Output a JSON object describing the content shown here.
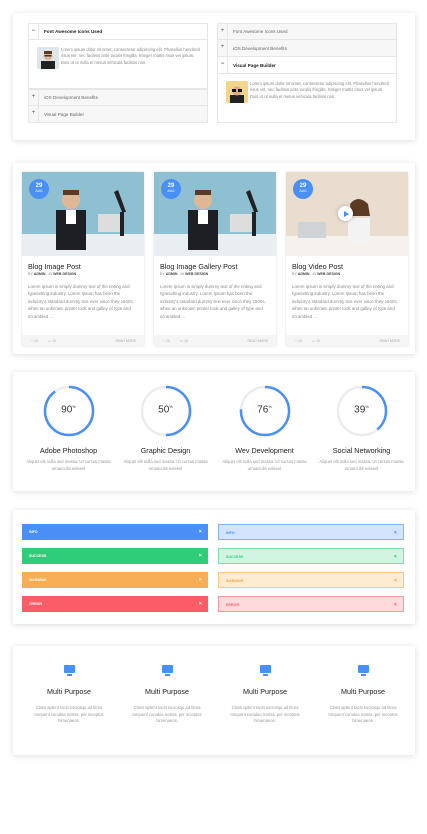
{
  "accordion": {
    "left": {
      "open_title": "Font Awesome Icons Used",
      "body": "Lorem ipsum dolor sit amet, consectetur adipiscing elit. Phasellus hendrerit risus vel, nec facilisis ante iaculis fringilla. Integer mattis risus vel ipsum. Duis ut ut nulla et metus vehicula facilisis non.",
      "items": [
        "iOS Development Benefits",
        "Visual Page Builder"
      ]
    },
    "right": {
      "items_top": [
        "Font Awesome Icons Used",
        "iOS Development Benefits"
      ],
      "open_title": "Visual Page Builder",
      "body": "Lorem ipsum dolor sit amet, consectetur adipiscing elit. Phasellus hendrerit risus vel, nec facilisis ante iaculis fringilla. Integer mattis risus vel ipsum. Duis ut ut nulla et metus vehicula facilisis non."
    }
  },
  "posts": [
    {
      "day": "29",
      "month": "AUG",
      "title": "Blog Image Post",
      "by": "BY",
      "author": "ADMIN",
      "in": "IN",
      "category": "WEB DESIGN",
      "excerpt": "Lorem Ipsum is simply dummy text of the rinting and typesetting industry. Lorem Ipsum has been the industry's standard dummy text ever since they 1500s, when an unknown printer took and galley of type and scrambled ...",
      "likes": "10",
      "comments": "10",
      "read_more": "READ MORE"
    },
    {
      "day": "29",
      "month": "AUG",
      "title": "Blog Image Gallery Post",
      "by": "BY",
      "author": "ADMIN",
      "in": "IN",
      "category": "WEB DESIGN",
      "excerpt": "Lorem Ipsum is simply dummy text of the rinting and typesetting industry. Lorem Ipsum has been the industry's standard dummy text ever since they 1500s, when an unknown printer took and galley of type and scrambled ...",
      "likes": "10",
      "comments": "10",
      "read_more": "READ MORE"
    },
    {
      "day": "29",
      "month": "AUG",
      "title": "Blog Video Post",
      "by": "BY",
      "author": "ADMIN",
      "in": "IN",
      "category": "WEB DESIGN",
      "excerpt": "Lorem Ipsum is simply dummy text of the rinting and typesetting industry. Lorem Ipsum has been the industry's standard dummy text ever since they 1500s, when an unknown printer took and galley of type and scrambled ...",
      "likes": "10",
      "comments": "10",
      "read_more": "READ MORE"
    }
  ],
  "stats": [
    {
      "value": 90,
      "label": "Adobe Photoshop",
      "desc": "Aliquet elit nulla sed massa. Ut cursus massa urnaeculis eeleeel"
    },
    {
      "value": 50,
      "label": "Graphic Design",
      "desc": "Aliquet elit nulla sed massa. Ut cursus massa urnaeculis eeleeel"
    },
    {
      "value": 76,
      "label": "Wev Development",
      "desc": "Aliquet elit nulla sed massa. Ut cursus massa urnaeculis eeleeel"
    },
    {
      "value": 39,
      "label": "Social Networking",
      "desc": "Aliquet elit nulla sed massa. Ut cursus massa urnaeculis eeleeel"
    }
  ],
  "percent_sign": "%",
  "alerts": {
    "solid": [
      "INFO",
      "SUCCESS",
      "WARNING",
      "ERROR"
    ],
    "light": [
      "INFO",
      "SUCCESS",
      "WARNING",
      "ERROR"
    ],
    "close_glyph": "×"
  },
  "features": [
    {
      "title": "Multi Purpose",
      "desc": "Class aptent taciti sociosqu ad litora torquent conubia nostra, per inceptos himenaeos."
    },
    {
      "title": "Multi Purpose",
      "desc": "Class aptent taciti sociosqu ad litora torquent conubia nostra, per inceptos himenaeos."
    },
    {
      "title": "Multi Purpose",
      "desc": "Class aptent taciti sociosqu ad litora torquent conubia nostra, per inceptos himenaeos."
    },
    {
      "title": "Multi Purpose",
      "desc": "Class aptent taciti sociosqu ad litora torquent conubia nostra, per inceptos himenaeos."
    }
  ],
  "colors": {
    "accent": "#4a8ff5",
    "ring_track": "#ececec"
  }
}
